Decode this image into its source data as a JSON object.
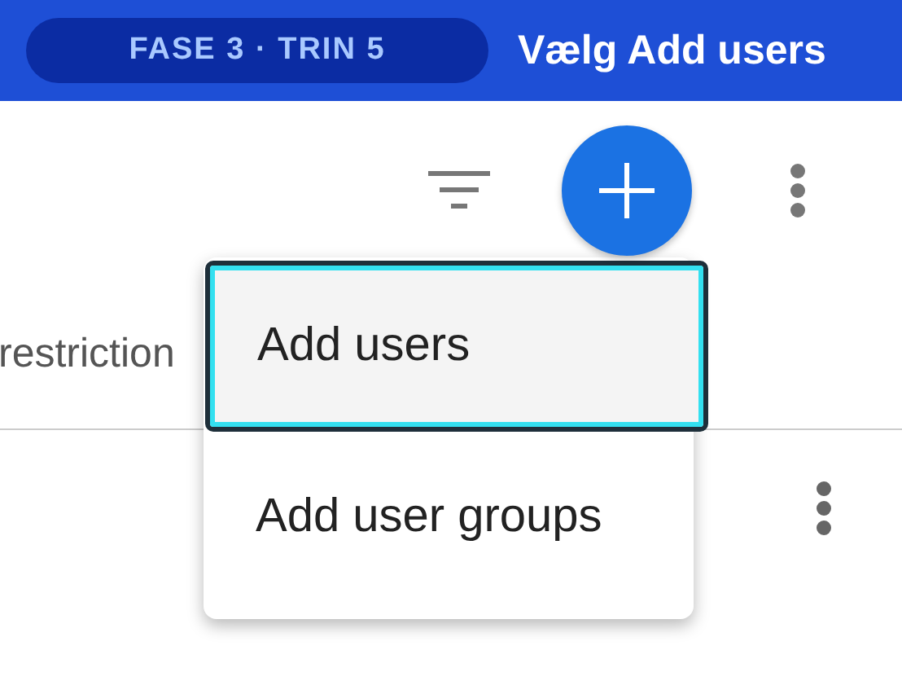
{
  "banner": {
    "badge": "FASE 3 · TRIN 5",
    "title": "Vælg Add users"
  },
  "table": {
    "columns": [
      "restriction"
    ]
  },
  "menu": {
    "items": [
      {
        "label": "Add users",
        "selected": true
      },
      {
        "label": "Add user groups",
        "selected": false
      }
    ]
  }
}
